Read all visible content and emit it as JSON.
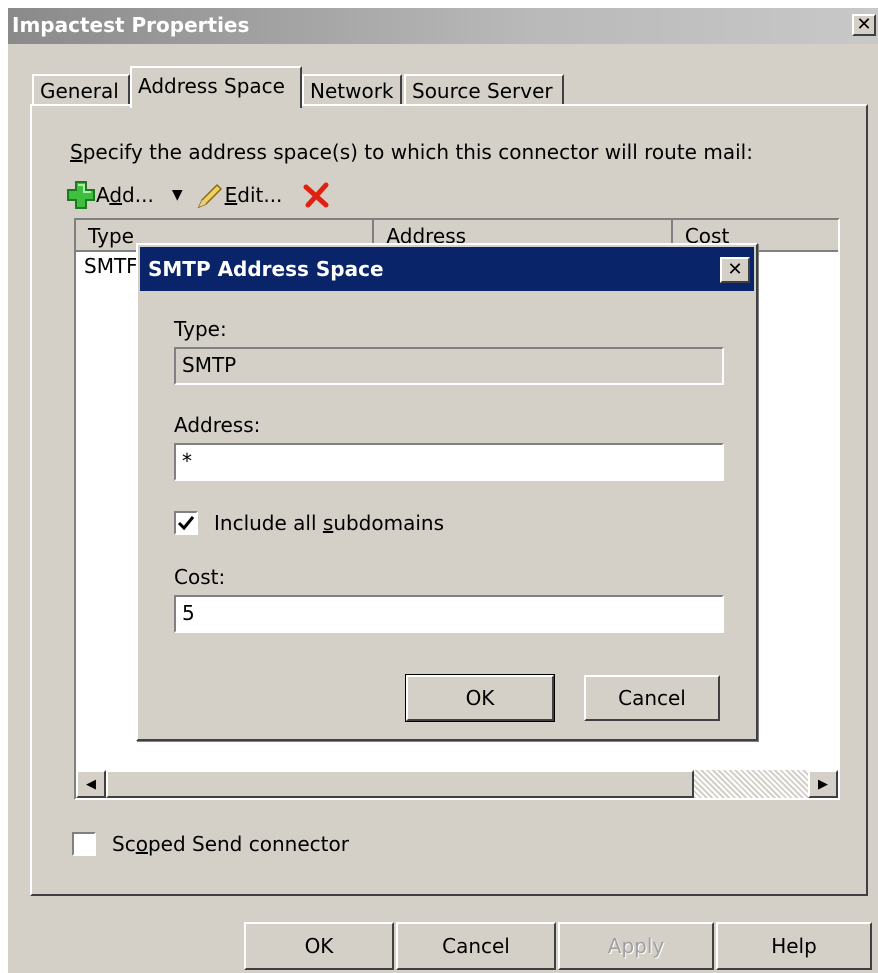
{
  "window": {
    "title": "Impactest Properties",
    "close_glyph": "✕"
  },
  "tabs": [
    {
      "label": "General"
    },
    {
      "label": "Address Space"
    },
    {
      "label": "Network"
    },
    {
      "label": "Source Server"
    }
  ],
  "address_space": {
    "instructions_prefix": "S",
    "instructions_rest": "pecify the address space(s) to which this connector will route mail:",
    "toolbar": {
      "add_pre": "A",
      "add_ul": "d",
      "add_post": "d...",
      "edit_ul": "E",
      "edit_post": "dit..."
    },
    "columns": [
      "Type",
      "Address",
      "Cost"
    ],
    "rows": [
      {
        "type": "SMTF"
      }
    ]
  },
  "scoped_send": {
    "pre": "Sc",
    "ul": "o",
    "post": "ped Send connector",
    "checked": false
  },
  "buttons": {
    "ok": "OK",
    "cancel": "Cancel",
    "apply": "Apply",
    "help": "Help"
  },
  "dialog": {
    "title": "SMTP Address Space",
    "type_label": "Type:",
    "type_value": "SMTP",
    "address_label": "Address:",
    "address_value": "*",
    "include_subdomains_pre": "Include all ",
    "include_subdomains_ul": "s",
    "include_subdomains_post": "ubdomains",
    "include_subdomains_checked": true,
    "cost_label": "Cost:",
    "cost_value": "5",
    "ok": "OK",
    "cancel": "Cancel"
  },
  "colors": {
    "dialog_title_bg": "#0a246a",
    "face": "#d4d0c8"
  }
}
